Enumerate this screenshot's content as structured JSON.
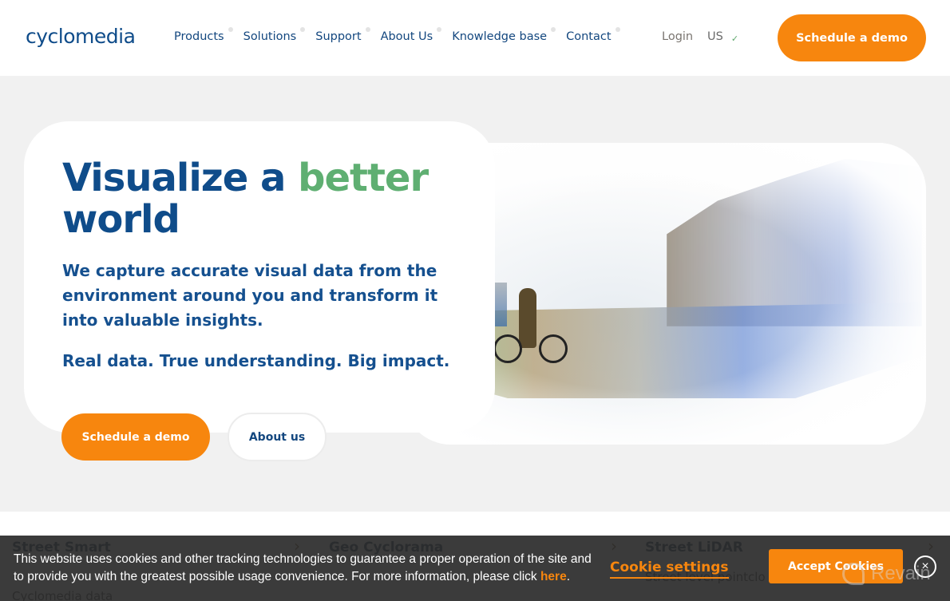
{
  "header": {
    "logo": "cyclomedia",
    "nav": [
      {
        "label": "Products"
      },
      {
        "label": "Solutions"
      },
      {
        "label": "Support"
      },
      {
        "label": "About Us"
      },
      {
        "label": "Knowledge base"
      },
      {
        "label": "Contact"
      }
    ],
    "login_label": "Login",
    "region": "US",
    "cta_label": "Schedule a demo"
  },
  "hero": {
    "headline_part1": "Visualize a ",
    "headline_accent": "better",
    "headline_part2": "world",
    "lead": "We capture accurate visual data from the environment around you and transform it into valuable insights.",
    "tagline": "Real data. True understanding. Big impact.",
    "primary_button": "Schedule a demo",
    "secondary_button": "About us",
    "image_alt": "Cyclist crossing a street blending into a point cloud"
  },
  "products": [
    {
      "title": "Street Smart",
      "desc": "Cyclomedia data"
    },
    {
      "title": "Geo Cyclorama",
      "desc": ""
    },
    {
      "title": "Street LiDAR",
      "desc": "Street level pointclo"
    }
  ],
  "cookie_bar": {
    "text_before_link": "This website uses cookies and other tracking technologies to guarantee a proper operation of the site and to provide you with the greatest possible usage convenience. For more information, please click ",
    "link_label": "here",
    "text_after_link": ".",
    "settings_label": "Cookie settings",
    "accept_label": "Accept Cookies",
    "close_icon": "×"
  },
  "watermark": "Revain",
  "colors": {
    "brand_blue": "#0f4c8a",
    "accent_green": "#5faf72",
    "accent_orange": "#f7860e",
    "hero_bg": "#f1f1f1",
    "cookie_bg": "#2c2c2c"
  }
}
